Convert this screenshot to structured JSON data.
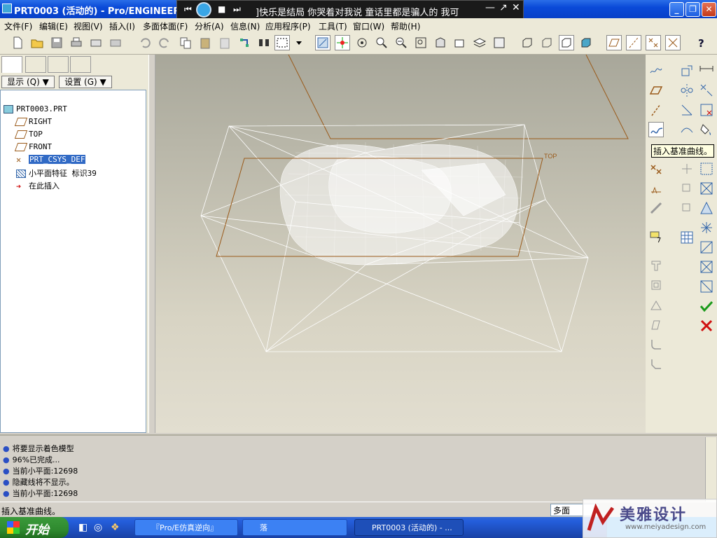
{
  "window": {
    "title": "PRT0003 (活动的) - Pro/ENGINEER W"
  },
  "media": {
    "song": "]快乐是结局   你哭着对我说   童话里都是骗人的  我可"
  },
  "menu": [
    "文件(F)",
    "编辑(E)",
    "视图(V)",
    "插入(I)",
    "多面体面(F)",
    "分析(A)",
    "信息(N)",
    "应用程序(P)",
    "工具(T)",
    "窗口(W)",
    "帮助(H)"
  ],
  "panel": {
    "show_label": "显示 (Q) ▼",
    "settings_label": "设置 (G) ▼"
  },
  "tree": {
    "root": "PRT0003.PRT",
    "items": [
      "RIGHT",
      "TOP",
      "FRONT",
      "PRT_CSYS_DEF",
      "小平面特征 标识39",
      "在此插入"
    ]
  },
  "viewport": {
    "datum_label": "TOP"
  },
  "tooltip": "插入基准曲线。",
  "messages": [
    "将要显示着色模型",
    "96%已完成...",
    "当前小平面:12698",
    "隐藏线将不显示。",
    "当前小平面:12698"
  ],
  "status": {
    "text": "插入基准曲线。",
    "filter": "多面"
  },
  "taskbar": {
    "start": "开始",
    "tasks": [
      "『Pro/E仿真逆向』",
      "落",
      "PRT0003 (活动的) - ..."
    ]
  },
  "watermark": {
    "title": "美雅设计",
    "url": "www.meiyadesign.com"
  },
  "colors": {
    "title_blue": "#0a4ad8",
    "viewport_top": "#a8a79a",
    "datum": "#9a5a1a"
  }
}
